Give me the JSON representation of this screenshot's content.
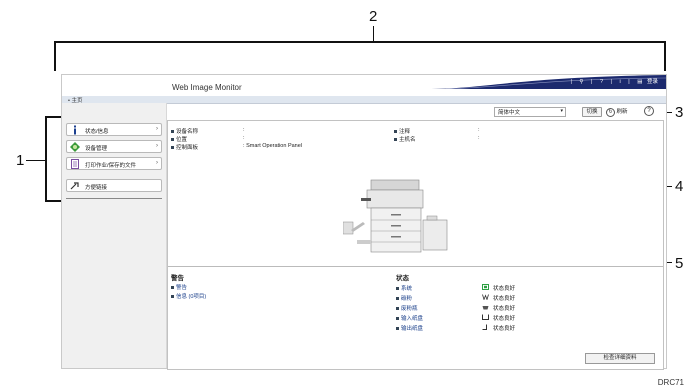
{
  "callouts": {
    "one": "1",
    "two": "2",
    "three": "3",
    "four": "4",
    "five": "5"
  },
  "header": {
    "title": "Web Image Monitor",
    "top_icons": [
      "search-icon",
      "help-icon",
      "info-icon",
      "menu-icon"
    ],
    "top_link": "登录",
    "breadcrumb": "• 主页"
  },
  "sidebar": {
    "items": [
      {
        "label": "状态/信息",
        "icon": "info-icon",
        "arrow": "›"
      },
      {
        "label": "设备管理",
        "icon": "device-management-icon",
        "arrow": "›"
      },
      {
        "label": "打印作业/保存的文件",
        "icon": "document-icon",
        "arrow": "›"
      },
      {
        "label": "方便链接",
        "icon": "link-icon",
        "arrow": ""
      }
    ]
  },
  "toolbar": {
    "language": "简体中文",
    "switch_label": "切换",
    "refresh_label": "刷新",
    "help_icon": "help-icon"
  },
  "device_info": {
    "left": [
      {
        "label": "设备名称",
        "sep": ":",
        "value": ""
      },
      {
        "label": "位置",
        "sep": ":",
        "value": ""
      },
      {
        "label": "控制面板",
        "sep": ":",
        "value": "Smart Operation Panel"
      }
    ],
    "right": [
      {
        "label": "注释",
        "sep": ":",
        "value": ""
      },
      {
        "label": "主机名",
        "sep": ":",
        "value": ""
      }
    ]
  },
  "alerts": {
    "title": "警告",
    "items": [
      "警告",
      "信息 (0项目)"
    ]
  },
  "status": {
    "title": "状态",
    "items": [
      {
        "name": "系统",
        "state": "状态良好"
      },
      {
        "name": "碳粉",
        "state": "状态良好"
      },
      {
        "name": "废粉瓶",
        "state": "状态良好"
      },
      {
        "name": "输入纸盘",
        "state": "状态良好"
      },
      {
        "name": "输出纸盘",
        "state": "状态良好"
      }
    ],
    "detail_button": "检查详细资料"
  },
  "code": "DRC71",
  "colors": {
    "accent": "#1c2a6e",
    "subbar": "#dfe6ef",
    "green": "#2ea043"
  }
}
